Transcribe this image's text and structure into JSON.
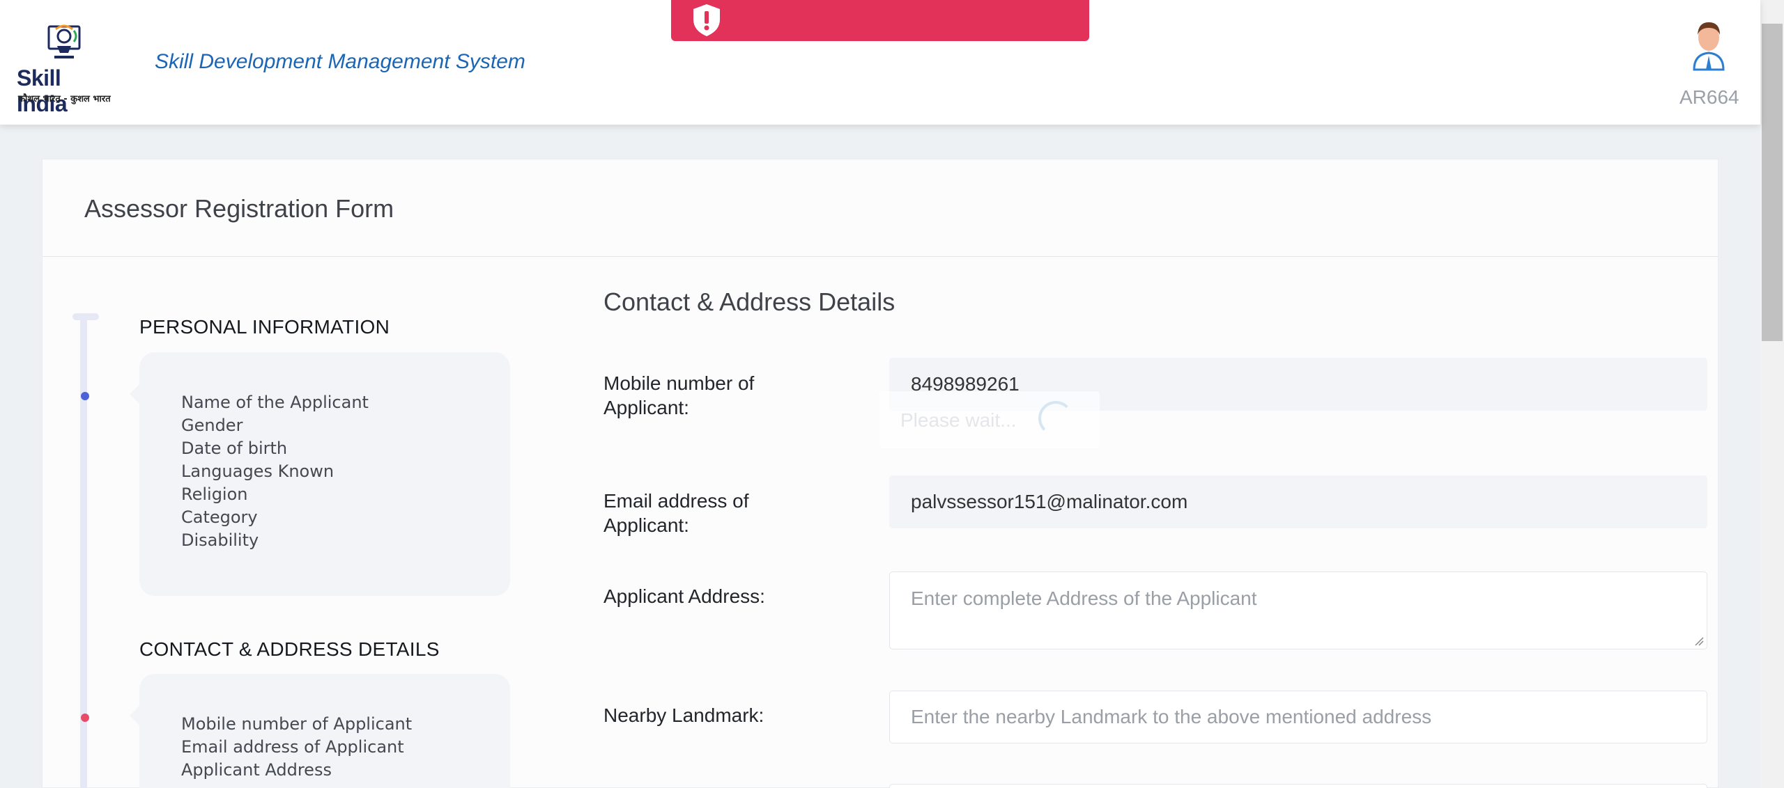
{
  "header": {
    "logo_brand": "Skill India",
    "logo_tagline": "कौशल भारत - कुशल भारत",
    "app_title": "Skill Development Management System",
    "user_id": "AR664"
  },
  "colors": {
    "toast": "#e2325a",
    "accent_blue": "#1a66b4",
    "step_active": "#e84a6a",
    "step_done": "#4b62d8"
  },
  "toast": {
    "icon": "alert-shield-icon"
  },
  "form": {
    "title": "Assessor Registration Form",
    "loading_text": "Please wait...",
    "steps": [
      {
        "heading": "PERSONAL INFORMATION",
        "items": [
          "Name of the Applicant",
          "Gender",
          "Date of birth",
          "Languages Known",
          "Religion",
          "Category",
          "Disability"
        ]
      },
      {
        "heading": "CONTACT & ADDRESS DETAILS",
        "items": [
          "Mobile number of Applicant",
          "Email address of Applicant",
          "Applicant Address"
        ]
      }
    ],
    "section": {
      "title": "Contact & Address Details",
      "fields": [
        {
          "label": "Mobile number of Applicant:",
          "value": "8498989261",
          "placeholder": ""
        },
        {
          "label": "Email address of Applicant:",
          "value": "palvssessor151@malinator.com",
          "placeholder": ""
        },
        {
          "label": "Applicant Address:",
          "value": "",
          "placeholder": "Enter complete Address of the Applicant"
        },
        {
          "label": "Nearby Landmark:",
          "value": "",
          "placeholder": "Enter the nearby Landmark to the above mentioned address"
        }
      ]
    }
  }
}
